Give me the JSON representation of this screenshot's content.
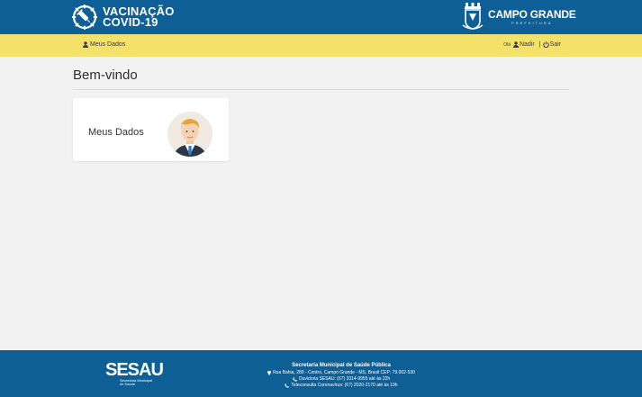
{
  "header": {
    "app_title_line1": "VACINAÇÃO",
    "app_title_line2": "COVID-19",
    "city_name": "CAMPO GRANDE",
    "city_subtitle": "PREFEITURA"
  },
  "nav": {
    "meus_dados": "Meus Dados",
    "greeting": "Olá",
    "user_name": "Nadir",
    "logout": "Sair"
  },
  "main": {
    "title": "Bem-vindo",
    "card": {
      "label": "Meus Dados"
    }
  },
  "footer": {
    "brand": "SESAU",
    "brand_sub_1": "Secretaria Municipal",
    "brand_sub_2": "de Saúde",
    "org": "Secretaria Municipal de Saúde Pública",
    "address": "Rua Bahia, 280 - Centro, Campo Grande - MS, Brasil CEP: 79.002-530",
    "ouvidoria": "Ouvidoria SESAU: (67) 3314-9955 até às 22h",
    "teleconsulta": "Teleconsulta Coronavírus: (67) 2020-2170 até às 19h"
  },
  "colors": {
    "header_blue": "#0d5f95",
    "nav_yellow": "#f4e169",
    "page_bg": "#f2f2f2"
  },
  "icons": [
    "syringe-badge-icon",
    "city-crest-icon",
    "user-icon",
    "power-icon",
    "map-pin-icon",
    "phone-icon"
  ]
}
